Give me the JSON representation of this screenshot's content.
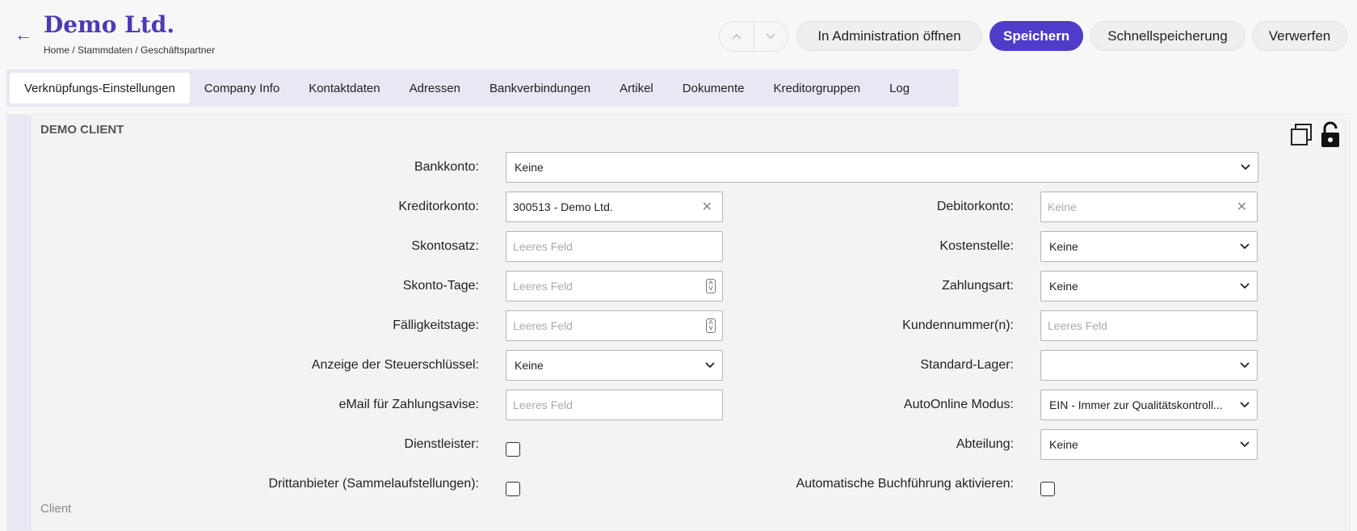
{
  "header": {
    "title": "Demo Ltd.",
    "breadcrumb": "Home / Stammdaten / Geschäftspartner",
    "buttons": {
      "admin": "In Administration öffnen",
      "save": "Speichern",
      "quick_save": "Schnellspeicherung",
      "discard": "Verwerfen"
    },
    "accent_color": "#4f3cc9"
  },
  "tabs": [
    {
      "label": "Verknüpfungs-Einstellungen",
      "active": true
    },
    {
      "label": "Company Info"
    },
    {
      "label": "Kontaktdaten"
    },
    {
      "label": "Adressen"
    },
    {
      "label": "Bankverbindungen"
    },
    {
      "label": "Artikel"
    },
    {
      "label": "Dokumente"
    },
    {
      "label": "Kreditorgruppen"
    },
    {
      "label": "Log"
    }
  ],
  "panel": {
    "title": "DEMO CLIENT",
    "footer": "Client",
    "icons": [
      "copy-icon",
      "unlock-icon"
    ]
  },
  "form": {
    "bankkonto": {
      "label": "Bankkonto:",
      "value": "Keine"
    },
    "kreditorkonto": {
      "label": "Kreditorkonto:",
      "value": "300513 - Demo Ltd."
    },
    "debitorkonto": {
      "label": "Debitorkonto:",
      "placeholder": "Keine"
    },
    "skontosatz": {
      "label": "Skontosatz:",
      "placeholder": "Leeres Feld"
    },
    "kostenstelle": {
      "label": "Kostenstelle:",
      "value": "Keine"
    },
    "skonto_tage": {
      "label": "Skonto-Tage:",
      "placeholder": "Leeres Feld"
    },
    "zahlungsart": {
      "label": "Zahlungsart:",
      "value": "Keine"
    },
    "faelligkeitstage": {
      "label": "Fälligkeitstage:",
      "placeholder": "Leeres Feld"
    },
    "kundennummer": {
      "label": "Kundennummer(n):",
      "placeholder": "Leeres Feld"
    },
    "steuerschluessel": {
      "label": "Anzeige der Steuerschlüssel:",
      "value": "Keine"
    },
    "standard_lager": {
      "label": "Standard-Lager:",
      "value": ""
    },
    "email_zahlungsavise": {
      "label": "eMail für Zahlungsavise:",
      "placeholder": "Leeres Feld"
    },
    "autoonline": {
      "label": "AutoOnline Modus:",
      "value": "EIN - Immer zur Qualitätskontroll..."
    },
    "dienstleister": {
      "label": "Dienstleister:",
      "checked": false
    },
    "abteilung": {
      "label": "Abteilung:",
      "value": "Keine"
    },
    "drittanbieter": {
      "label": "Drittanbieter (Sammelaufstellungen):",
      "checked": false
    },
    "auto_buchfuehrung": {
      "label": "Automatische Buchführung aktivieren:",
      "checked": false
    }
  }
}
